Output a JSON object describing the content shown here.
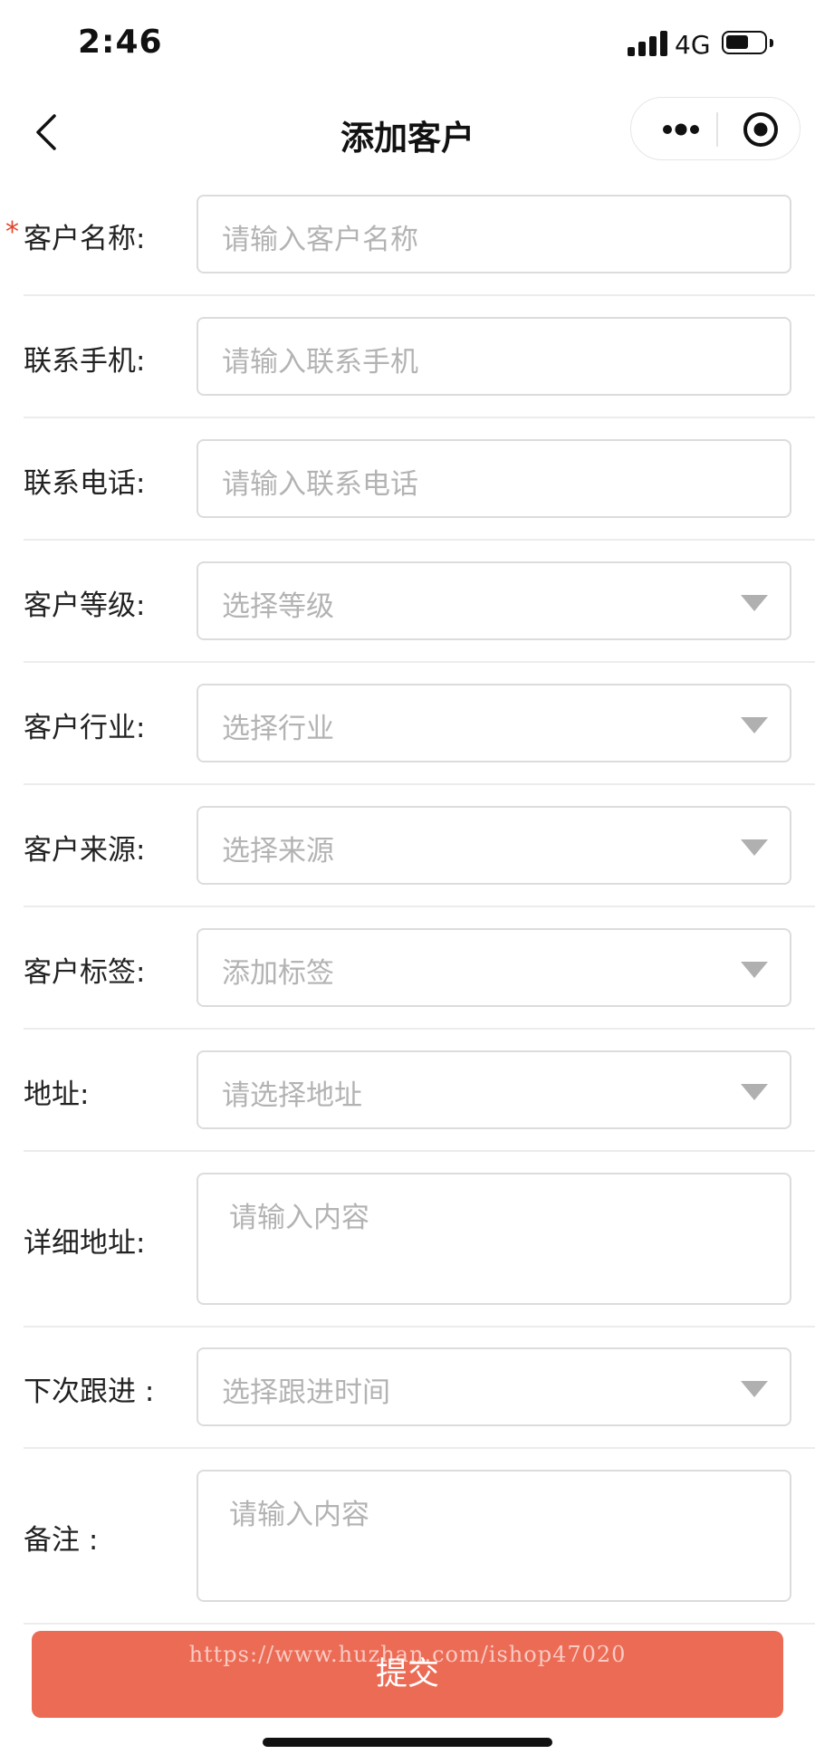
{
  "status_bar": {
    "time": "2:46",
    "network": "4G",
    "battery_level": 0.6
  },
  "nav": {
    "title": "添加客户",
    "back_icon": "chevron-left-icon",
    "more_icon": "more-icon",
    "close_icon": "target-icon"
  },
  "form": {
    "required_mark": "*",
    "fields": [
      {
        "label": "客户名称:",
        "placeholder": "请输入客户名称",
        "type": "text",
        "required": true
      },
      {
        "label": "联系手机:",
        "placeholder": "请输入联系手机",
        "type": "text"
      },
      {
        "label": "联系电话:",
        "placeholder": "请输入联系电话",
        "type": "text"
      },
      {
        "label": "客户等级:",
        "placeholder": "选择等级",
        "type": "select"
      },
      {
        "label": "客户行业:",
        "placeholder": "选择行业",
        "type": "select"
      },
      {
        "label": "客户来源:",
        "placeholder": "选择来源",
        "type": "select"
      },
      {
        "label": "客户标签:",
        "placeholder": "添加标签",
        "type": "select"
      },
      {
        "label": "地址:",
        "placeholder": "请选择地址",
        "type": "select"
      },
      {
        "label": "详细地址:",
        "placeholder": "请输入内容",
        "type": "textarea"
      },
      {
        "label": "下次跟进 :",
        "placeholder": "选择跟进时间",
        "type": "select"
      },
      {
        "label": "备注 :",
        "placeholder": "请输入内容",
        "type": "textarea"
      }
    ]
  },
  "submit": {
    "label": "提交"
  },
  "watermark": "https://www.huzhan.com/ishop47020"
}
